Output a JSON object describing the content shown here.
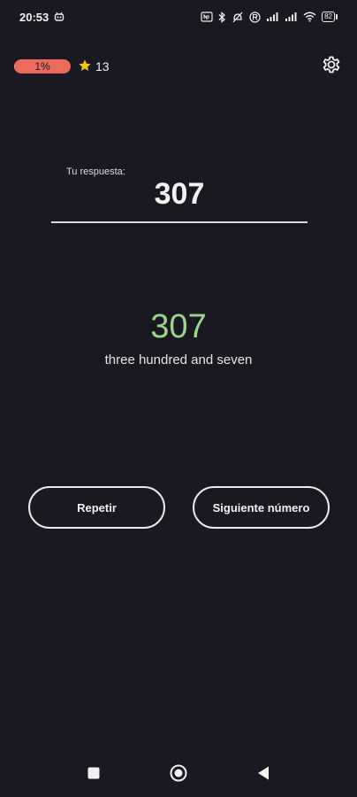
{
  "status_bar": {
    "time": "20:53",
    "icons": [
      "app-notification-icon",
      "nfc-icon",
      "bluetooth-icon",
      "do-not-disturb-icon",
      "registered-icon",
      "signal-icon",
      "signal-icon",
      "wifi-icon"
    ],
    "battery_level": "82"
  },
  "top_bar": {
    "progress_label": "1%",
    "progress_fraction": 0.01,
    "progress_color": "#ec6a5e",
    "stars_count": "13",
    "star_icon": "star-icon",
    "settings_icon": "gear-icon"
  },
  "answer": {
    "label": "Tu respuesta:",
    "value": "307"
  },
  "correct": {
    "number": "307",
    "words": "three hundred and seven",
    "color": "#9bd68b"
  },
  "buttons": {
    "repeat_label": "Repetir",
    "next_label": "Siguiente número"
  },
  "nav_bar": {
    "recents_icon": "square-icon",
    "home_icon": "circle-icon",
    "back_icon": "triangle-back-icon"
  }
}
